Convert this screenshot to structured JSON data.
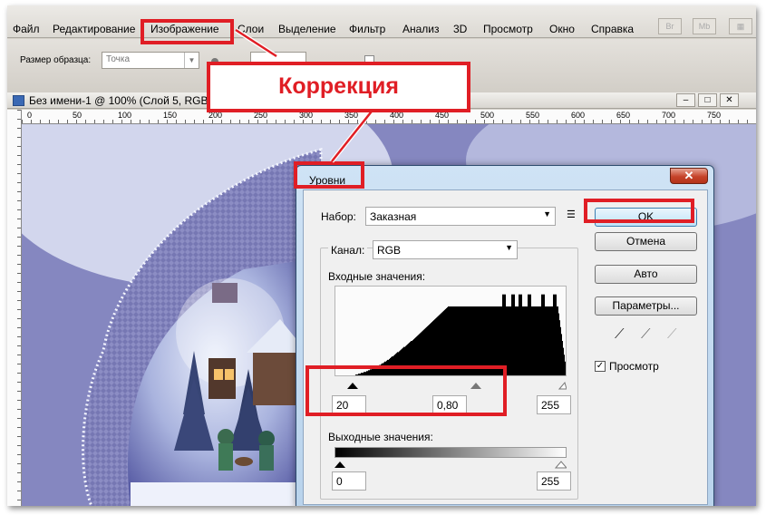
{
  "menubar": {
    "items": [
      "Файл",
      "Редактирование",
      "Изображение",
      "Слои",
      "Выделение",
      "Фильтр",
      "Анализ",
      "3D",
      "Просмотр",
      "Окно",
      "Справка"
    ],
    "highlighted": "Изображение",
    "bridge_btn": "Br",
    "mini_btn": "Mb"
  },
  "options_bar": {
    "sample_size_label": "Размер образца:",
    "sample_size_value": "Точка"
  },
  "document": {
    "title": "Без имени-1 @ 100% (Слой 5, RGB/8)",
    "ruler_ticks": [
      "0",
      "50",
      "100",
      "150",
      "200",
      "250",
      "300",
      "350",
      "400",
      "450",
      "500",
      "550",
      "600",
      "650",
      "700",
      "750"
    ]
  },
  "annotation": {
    "callout_text": "Коррекция",
    "color": "#e01e25"
  },
  "levels_dialog": {
    "title": "Уровни",
    "preset_label": "Набор:",
    "preset_value": "Заказная",
    "channel_label": "Канал:",
    "channel_value": "RGB",
    "input_levels_label": "Входные значения:",
    "input_black": "20",
    "input_gamma": "0,80",
    "input_white": "255",
    "output_levels_label": "Выходные значения:",
    "output_black": "0",
    "output_white": "255",
    "buttons": {
      "ok": "OK",
      "cancel": "Отмена",
      "auto": "Авто",
      "options": "Параметры..."
    },
    "preview_label": "Просмотр",
    "preview_checked": true,
    "histogram": [
      0,
      0,
      0,
      0,
      0,
      0,
      0,
      0,
      0,
      0,
      0,
      0,
      0,
      0,
      0,
      0,
      0,
      0,
      0,
      0,
      0,
      0,
      1,
      1,
      1,
      2,
      2,
      2,
      3,
      3,
      3,
      4,
      4,
      4,
      5,
      5,
      6,
      6,
      7,
      7,
      8,
      8,
      9,
      9,
      10,
      10,
      11,
      11,
      12,
      12,
      13,
      14,
      14,
      15,
      16,
      16,
      17,
      18,
      18,
      19,
      20,
      21,
      22,
      22,
      23,
      24,
      25,
      26,
      27,
      27,
      28,
      29,
      30,
      31,
      32,
      33,
      33,
      34,
      35,
      36,
      37,
      38,
      39,
      40,
      40,
      41,
      42,
      43,
      44,
      45,
      46,
      47,
      48,
      49,
      50,
      51,
      52,
      53,
      54,
      55,
      56,
      57,
      58,
      59,
      60,
      61,
      62,
      63,
      64,
      65,
      66,
      67,
      68,
      69,
      70,
      71,
      72,
      73,
      74,
      75,
      76,
      77,
      78,
      79,
      80,
      80,
      80,
      80,
      80,
      80,
      80,
      80,
      80,
      80,
      80,
      80,
      80,
      80,
      80,
      80,
      80,
      80,
      80,
      80,
      80,
      80,
      80,
      80,
      80,
      80,
      80,
      80,
      80,
      80,
      80,
      80,
      80,
      80,
      80,
      80,
      80,
      80,
      80,
      80,
      80,
      80,
      80,
      80,
      80,
      80,
      80,
      80,
      80,
      80,
      80,
      80,
      80,
      80,
      80,
      80,
      80,
      80,
      80,
      80,
      80,
      80,
      80,
      80,
      80,
      80,
      80,
      80,
      80,
      80,
      80,
      80,
      80,
      80,
      80,
      80,
      80,
      80,
      80,
      80,
      80,
      80,
      80,
      80,
      80,
      80,
      80,
      80,
      80,
      80,
      80,
      80,
      80,
      80,
      80,
      80,
      80,
      80,
      80,
      80,
      80,
      80,
      80,
      80,
      80,
      80,
      80,
      80,
      80,
      80,
      80,
      80,
      80,
      80,
      80,
      80,
      80,
      80,
      80,
      80,
      80,
      80,
      80,
      80,
      80,
      80,
      80,
      80,
      80,
      80,
      80,
      80
    ]
  }
}
